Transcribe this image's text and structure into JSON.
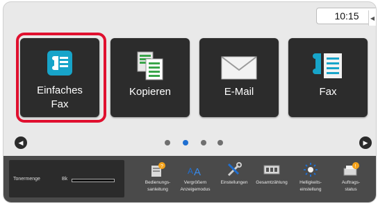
{
  "status": {
    "time": "10:15"
  },
  "tiles": [
    {
      "label_line1": "Einfaches",
      "label_line2": "Fax",
      "selected": true
    },
    {
      "label": "Kopieren"
    },
    {
      "label": "E-Mail"
    },
    {
      "label": "Fax"
    }
  ],
  "pagination": {
    "count": 4,
    "active_index": 1
  },
  "toner": {
    "label": "Tonermenge",
    "color_label": "Bk"
  },
  "tools": [
    {
      "line1": "Bedienungs-",
      "line2": "sanleitung",
      "icon": "manual-icon"
    },
    {
      "line1": "Vergrößern",
      "line2": "Anzeigemodus",
      "icon": "zoom-display-icon"
    },
    {
      "line1": "Einstellungen",
      "line2": "",
      "icon": "settings-tools-icon"
    },
    {
      "line1": "Gesamtzählung",
      "line2": "",
      "icon": "counter-icon"
    },
    {
      "line1": "Helligkeits-",
      "line2": "einstellung",
      "icon": "brightness-icon"
    },
    {
      "line1": "Auftrags-",
      "line2": "status",
      "icon": "job-status-icon"
    }
  ],
  "colors": {
    "selection": "#e0102f",
    "tile_bg": "#2c2c2c",
    "accent_blue": "#1f6fd1"
  }
}
